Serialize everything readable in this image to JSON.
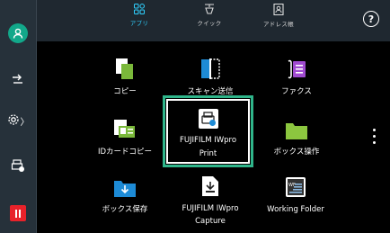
{
  "sidebar": {
    "user": {
      "icon": "user-icon",
      "color": "#12a88a"
    },
    "login_logout": {
      "icon": "login-logout-icon"
    },
    "settings": {
      "icon": "gear-icon",
      "chevron": "〉"
    },
    "job_status": {
      "icon": "job-status-icon"
    },
    "stop": {
      "icon": "stop-icon",
      "color": "#e8222a"
    }
  },
  "tabs": [
    {
      "label": "アプリ",
      "icon": "apps-grid-icon",
      "active": true
    },
    {
      "label": "クイック",
      "icon": "quick-icon",
      "active": false
    },
    {
      "label": "アドレス帳",
      "icon": "address-book-icon",
      "active": false
    }
  ],
  "help": {
    "label": "?"
  },
  "apps": [
    {
      "label": "コピー",
      "icon": "copy-icon"
    },
    {
      "label": "スキャン送信",
      "icon": "scan-send-icon"
    },
    {
      "label": "ファクス",
      "icon": "fax-icon"
    },
    {
      "label": "IDカードコピー",
      "icon": "id-card-copy-icon"
    },
    {
      "label": "FUJIFILM IWpro",
      "label2": "Print",
      "icon": "iwpro-print-icon",
      "selected": true
    },
    {
      "label": "ボックス操作",
      "icon": "box-operation-icon"
    },
    {
      "label": "ボックス保存",
      "icon": "box-save-icon"
    },
    {
      "label": "FUJIFILM IWpro",
      "label2": "Capture",
      "icon": "iwpro-capture-icon"
    },
    {
      "label": "Working Folder",
      "icon": "working-folder-icon"
    }
  ],
  "colors": {
    "accent": "#2fd1ff",
    "selection": "#2fb58a",
    "green_icon": "#7ab83a",
    "blue_icon": "#1d8bd6"
  }
}
